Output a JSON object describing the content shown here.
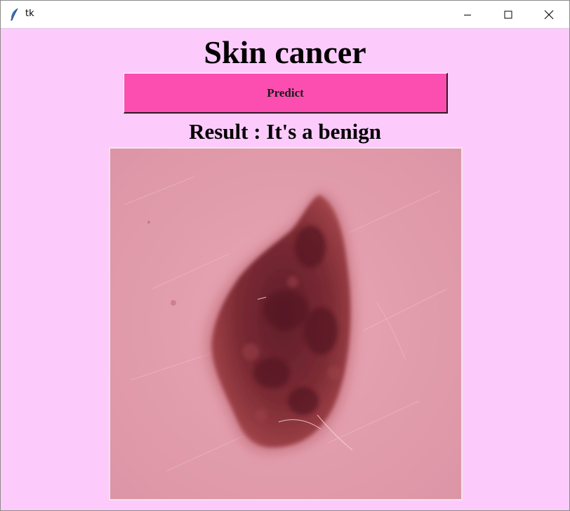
{
  "window": {
    "title": "tk",
    "controls": {
      "minimize": "minimize-icon",
      "maximize": "maximize-icon",
      "close": "close-icon"
    }
  },
  "main": {
    "heading": "Skin cancer",
    "predict_label": "Predict",
    "result_text": "Result : It's a benign"
  },
  "colors": {
    "background": "#fccbfc",
    "button": "#fb4eb0",
    "skin": "#e49fae",
    "lesion": "#7a2832"
  }
}
